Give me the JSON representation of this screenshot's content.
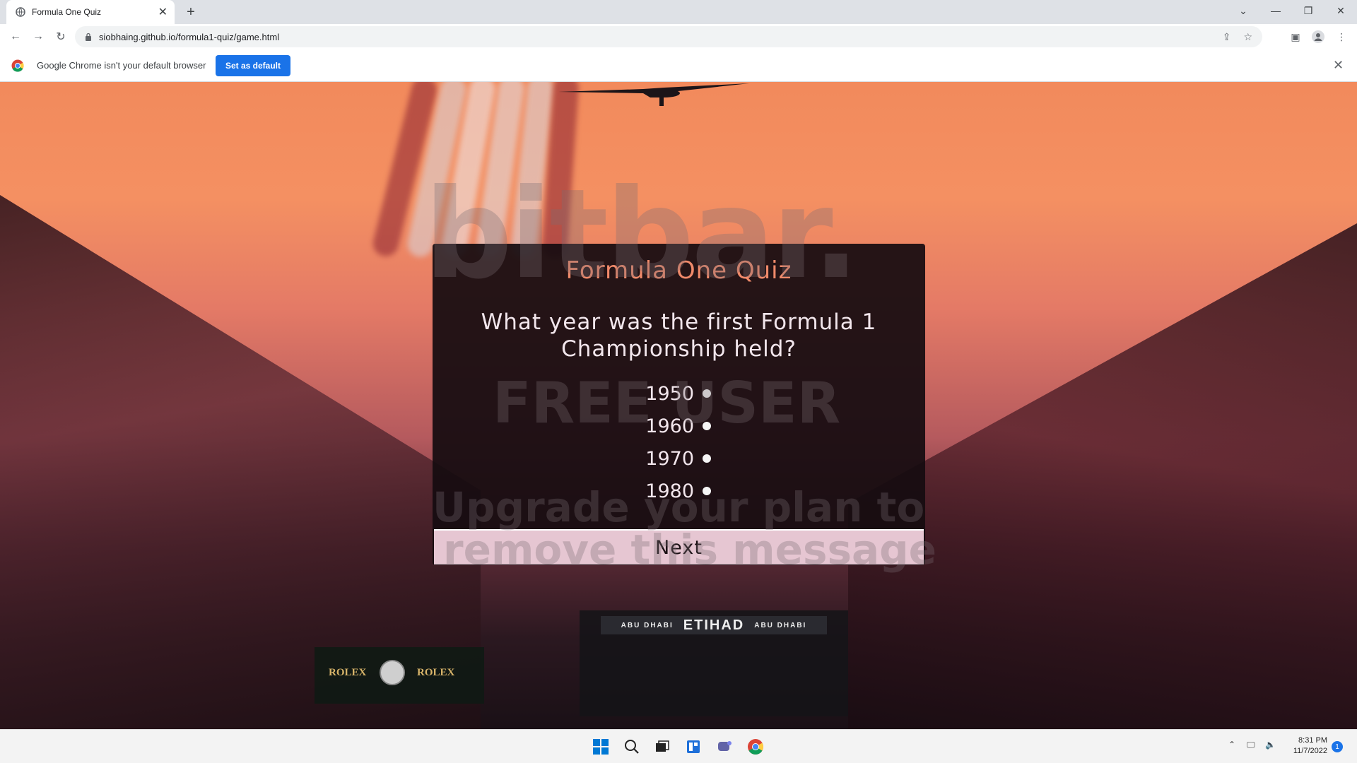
{
  "browser": {
    "tab_title": "Formula One Quiz",
    "url": "siobhaing.github.io/formula1-quiz/game.html",
    "infobar_message": "Google Chrome isn't your default browser",
    "set_default_label": "Set as default"
  },
  "quiz": {
    "title": "Formula One Quiz",
    "question": "What year was the first Formula 1 Championship held?",
    "answers": [
      "1950",
      "1960",
      "1970",
      "1980"
    ],
    "next_label": "Next"
  },
  "background": {
    "gate_sign": "ETIHAD",
    "gate_left": "ABU DHABI",
    "gate_right": "ABU DHABI",
    "rolex_left": "ROLEX",
    "rolex_right": "ROLEX"
  },
  "watermark": {
    "line1": "bitbar.",
    "line2": "FREE USER",
    "line3": "Upgrade your plan to",
    "line4": "remove this message"
  },
  "taskbar": {
    "time": "8:31 PM",
    "date": "11/7/2022",
    "notifications": "1"
  },
  "colors": {
    "quiz_title": "#f08a6a",
    "next_button": "#e6c6d2",
    "set_default_button": "#1a73e8"
  }
}
